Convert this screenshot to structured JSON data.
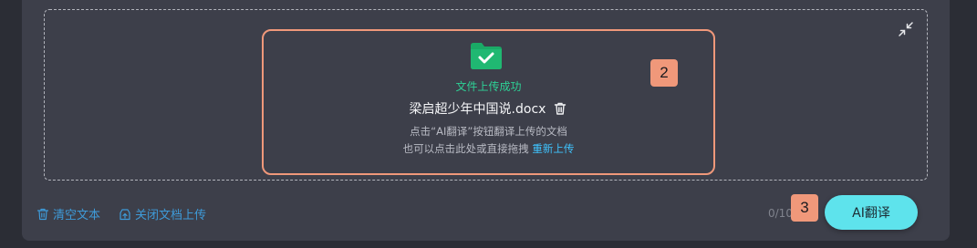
{
  "upload": {
    "status": "文件上传成功",
    "file_name": "梁启超少年中国说.docx",
    "hint_line1": "点击“AI翻译”按钮翻译上传的文档",
    "hint_line2_prefix": "也可以点击此处或直接拖拽",
    "reupload_label": "重新上传"
  },
  "badges": {
    "card": "2",
    "button": "3"
  },
  "footer": {
    "clear_label": "清空文本",
    "close_upload_label": "关闭文档上传",
    "counter": "0/10",
    "translate_label": "AI翻译"
  },
  "icons": {
    "folder": "folder-check-icon",
    "trash": "trash-icon",
    "collapse": "collapse-icon",
    "close_upload": "upload-icon"
  },
  "colors": {
    "success": "#2ed196",
    "link": "#3fc4ff",
    "accent_button": "#5ee3ec",
    "highlight": "#f0987a"
  }
}
